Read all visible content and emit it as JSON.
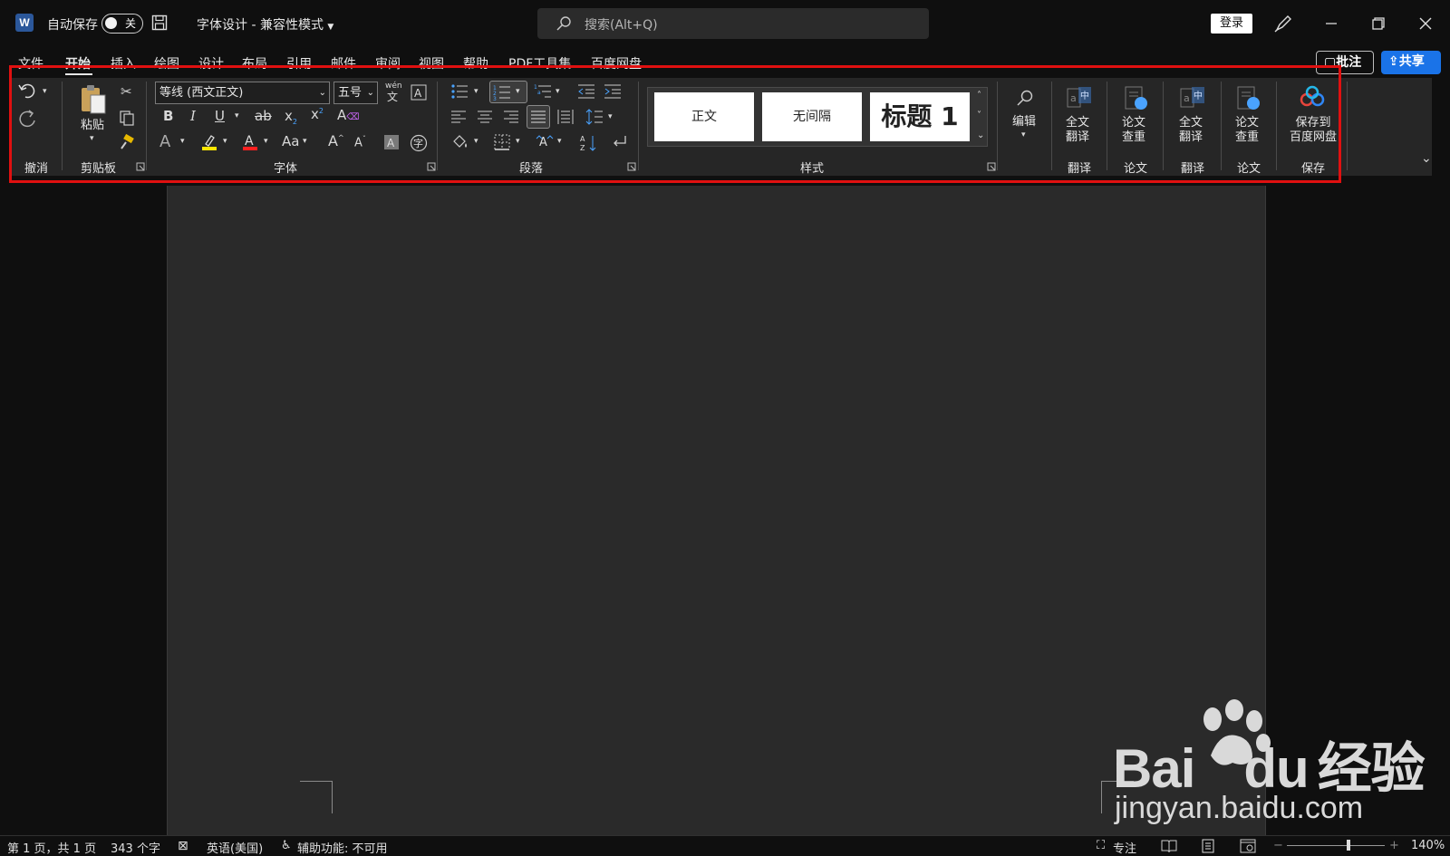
{
  "titlebar": {
    "app_icon_letter": "W",
    "autosave_label": "自动保存",
    "autosave_state": "关",
    "doc_title": "字体设计",
    "doc_mode": "兼容性模式",
    "search_placeholder": "搜索(Alt+Q)",
    "login_label": "登录"
  },
  "menu": {
    "tabs": [
      "文件",
      "开始",
      "插入",
      "绘图",
      "设计",
      "布局",
      "引用",
      "邮件",
      "审阅",
      "视图",
      "帮助",
      "PDF工具集",
      "百度网盘"
    ],
    "active_tab": "开始",
    "comment_label": "批注",
    "share_label": "共享"
  },
  "ribbon": {
    "groups": {
      "undo": "撤消",
      "clipboard": "剪贴板",
      "font": "字体",
      "paragraph": "段落",
      "styles": "样式",
      "translate1": "翻译",
      "paper1": "论文",
      "translate2": "翻译",
      "paper2": "论文",
      "save": "保存"
    },
    "paste_label": "粘贴",
    "font_name": "等线 (西文正文)",
    "font_size": "五号",
    "phonetic_label": "wén",
    "styles": [
      "正文",
      "无间隔",
      "标题 1"
    ],
    "edit_label": "编辑",
    "full_translate_1": "全文",
    "full_translate_2": "翻译",
    "paper_check_1": "论文",
    "paper_check_2": "查重",
    "save_baidu_1": "保存到",
    "save_baidu_2": "百度网盘"
  },
  "statusbar": {
    "page": "第 1 页，共 1 页",
    "words": "343 个字",
    "language": "英语(美国)",
    "accessibility": "辅助功能: 不可用",
    "focus": "专注",
    "zoom": "140%",
    "zoom_level": 0.63
  },
  "watermark": {
    "brand": "Bai",
    "brand_du": "du",
    "brand_cn": "经验",
    "url": "jingyan.baidu.com"
  },
  "colors": {
    "highlight": "#ffe600",
    "font_color": "#ff2020",
    "share_bg": "#1a73e8",
    "annotation_red": "#e01010"
  }
}
